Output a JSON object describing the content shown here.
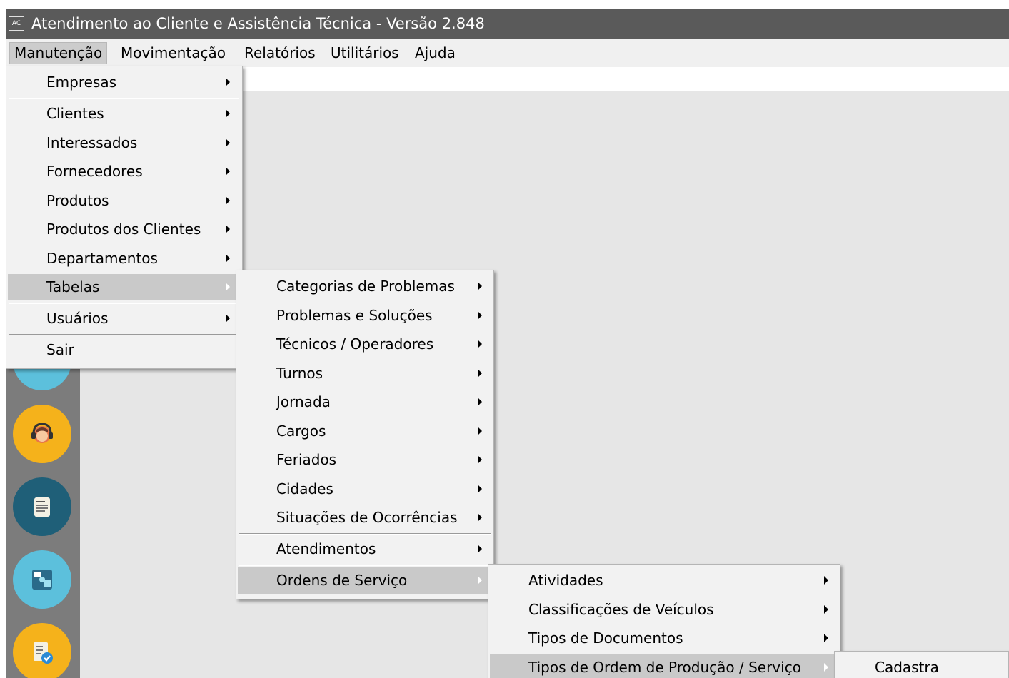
{
  "window": {
    "app_icon_text": "AC",
    "title": "Atendimento ao Cliente e Assistência Técnica - Versão 2.848"
  },
  "menubar": [
    {
      "label": "Manutenção",
      "active": true
    },
    {
      "label": "Movimentação"
    },
    {
      "label": "Relatórios"
    },
    {
      "label": "Utilitários"
    },
    {
      "label": "Ajuda"
    }
  ],
  "menu_manutencao": [
    {
      "label": "Empresas",
      "submenu": true
    },
    {
      "label": "Clientes",
      "submenu": true
    },
    {
      "label": "Interessados",
      "submenu": true
    },
    {
      "label": "Fornecedores",
      "submenu": true
    },
    {
      "label": "Produtos",
      "submenu": true
    },
    {
      "label": "Produtos dos Clientes",
      "submenu": true
    },
    {
      "label": "Departamentos",
      "submenu": true
    },
    {
      "label": "Tabelas",
      "submenu": true,
      "highlighted": true
    },
    {
      "label": "Usuários",
      "submenu": true
    },
    {
      "label": "Sair",
      "submenu": false
    }
  ],
  "menu_tabelas": [
    {
      "label": "Categorias de Problemas",
      "submenu": true
    },
    {
      "label": "Problemas e Soluções",
      "submenu": true
    },
    {
      "label": "Técnicos / Operadores",
      "submenu": true
    },
    {
      "label": "Turnos",
      "submenu": true
    },
    {
      "label": "Jornada",
      "submenu": true
    },
    {
      "label": "Cargos",
      "submenu": true
    },
    {
      "label": "Feriados",
      "submenu": true
    },
    {
      "label": "Cidades",
      "submenu": true
    },
    {
      "label": "Situações de Ocorrências",
      "submenu": true
    },
    {
      "label": "Atendimentos",
      "submenu": true
    },
    {
      "label": "Ordens de Serviço",
      "submenu": true,
      "highlighted": true
    }
  ],
  "menu_ordens_servico": [
    {
      "label": "Atividades",
      "submenu": true
    },
    {
      "label": "Classificações de Veículos",
      "submenu": true
    },
    {
      "label": "Tipos de Documentos",
      "submenu": true
    },
    {
      "label": "Tipos de Ordem de Produção / Serviço",
      "submenu": true,
      "highlighted": true
    }
  ],
  "menu_tipos_ordem": [
    {
      "label": "Cadastra"
    }
  ],
  "sidebar_launchers": [
    {
      "icon": "support-headset-icon",
      "color": "#f5b21b"
    },
    {
      "icon": "service-order-document-icon",
      "color": "#1f5f78"
    },
    {
      "icon": "service-order-puzzle-icon",
      "color": "#5cc0dc"
    },
    {
      "icon": "checklist-approved-icon",
      "color": "#f5b21b"
    }
  ]
}
